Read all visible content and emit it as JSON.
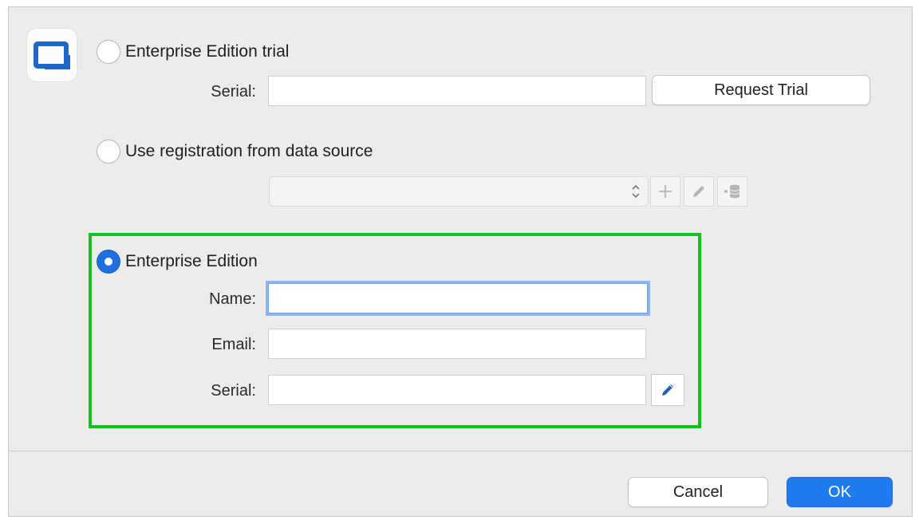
{
  "options": {
    "trial": {
      "label": "Enterprise Edition trial",
      "selected": false
    },
    "data_source": {
      "label": "Use registration from data source",
      "selected": false
    },
    "enterprise": {
      "label": "Enterprise Edition",
      "selected": true
    }
  },
  "trial": {
    "serial_label": "Serial:",
    "serial_value": "",
    "request_button": "Request Trial"
  },
  "data_source": {
    "select_value": ""
  },
  "enterprise": {
    "name_label": "Name:",
    "name_value": "",
    "email_label": "Email:",
    "email_value": "",
    "serial_label": "Serial:",
    "serial_value": ""
  },
  "footer": {
    "cancel_label": "Cancel",
    "ok_label": "OK"
  },
  "colors": {
    "accent": "#1f7cf0",
    "highlight_border": "#14c01d",
    "dialog_bg": "#ececec"
  },
  "icons": {
    "app": "app-window-icon",
    "add": "plus-icon",
    "edit": "pencil-icon",
    "database": "database-icon"
  }
}
